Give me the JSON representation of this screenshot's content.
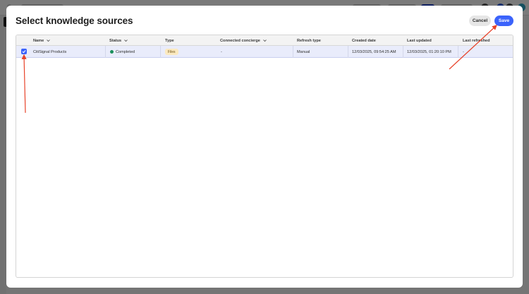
{
  "modal": {
    "title": "Select knowledge sources",
    "cancel_label": "Cancel",
    "save_label": "Save"
  },
  "table": {
    "columns": [
      {
        "label": "Name",
        "sortable": true
      },
      {
        "label": "Status",
        "sortable": true
      },
      {
        "label": "Type",
        "sortable": false
      },
      {
        "label": "Connected concierge",
        "sortable": true
      },
      {
        "label": "Refresh type",
        "sortable": false
      },
      {
        "label": "Created date",
        "sortable": false
      },
      {
        "label": "Last updated",
        "sortable": false
      },
      {
        "label": "Last refreshed",
        "sortable": false
      }
    ],
    "rows": [
      {
        "selected": true,
        "name": "CitiSignal Products",
        "status": "Completed",
        "type": "Files",
        "connected_concierge": "-",
        "refresh_type": "Manual",
        "created_date": "12/03/2025, 09:54:25 AM",
        "last_updated": "12/03/2025, 01:20:10 PM",
        "last_refreshed": "-"
      }
    ]
  },
  "colors": {
    "accent": "#3b63fb",
    "status_completed": "#1a8f5c",
    "badge_bg": "#fbe9bf",
    "annotation_arrow": "#e8432a",
    "selected_row": "#e9ecfb"
  },
  "icons": {
    "sort": "chevron-down-icon",
    "checkbox": "checkmark-icon"
  }
}
